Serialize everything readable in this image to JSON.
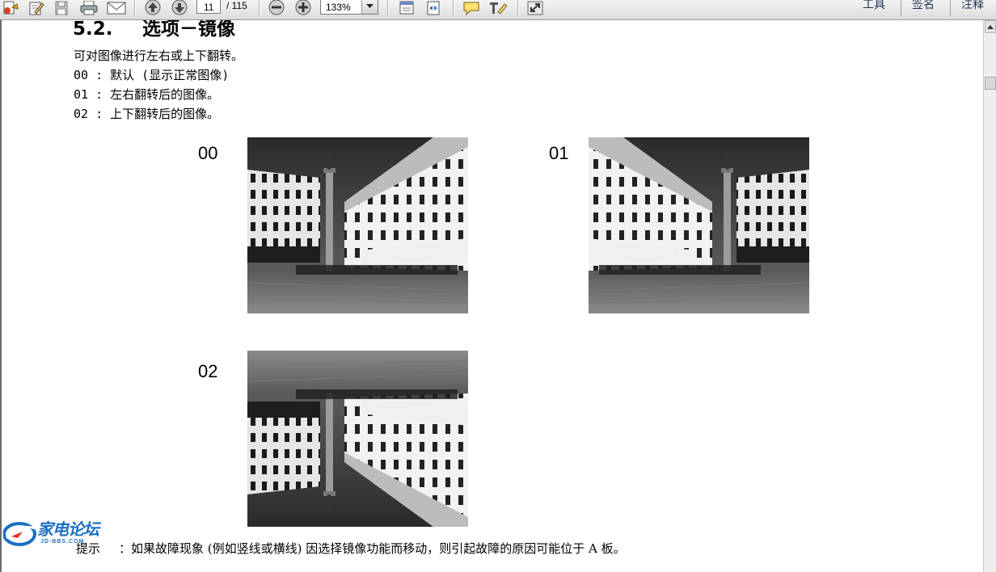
{
  "toolbar": {
    "page_current": "11",
    "page_total": "/ 115",
    "zoom": "133%",
    "right_tools": "工具",
    "right_sign": "签名",
    "right_comment": "注释"
  },
  "document": {
    "heading_number": "5.2.",
    "heading_title": "选项－镜像",
    "intro": "可对图像进行左右或上下翻转。",
    "options": [
      "00 : 默认 (显示正常图像)",
      "01 : 左右翻转后的图像。",
      "02 : 上下翻转后的图像。"
    ],
    "figures": [
      {
        "label": "00"
      },
      {
        "label": "01"
      },
      {
        "label": "02"
      }
    ],
    "footnote_prefix": "提示",
    "footnote": "：如果故障现象 (例如竖线或横线) 因选择镜像功能而移动，则引起故障的原因可能位于 A 板。"
  },
  "watermark": {
    "text": "家电论坛",
    "sub": "JD-BBS.COM"
  }
}
